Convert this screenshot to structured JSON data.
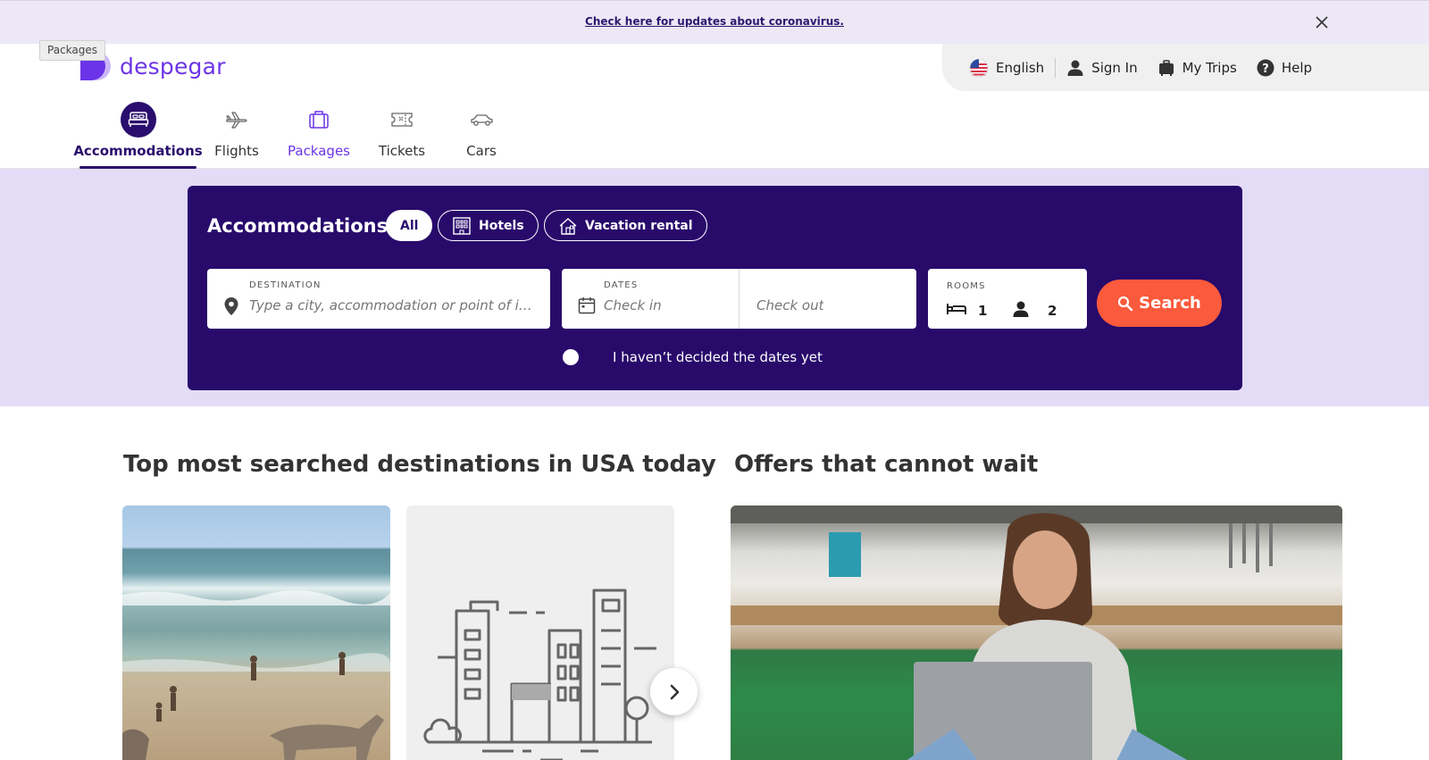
{
  "banner": {
    "link_text": "Check here for updates about coronavirus."
  },
  "tooltip": {
    "text": "Packages"
  },
  "brand": {
    "name": "despegar",
    "color": "#6b34e8"
  },
  "topbar": {
    "language": "English",
    "sign_in": "Sign In",
    "my_trips": "My Trips",
    "help": "Help"
  },
  "products": [
    {
      "label": "Accommodations",
      "icon": "bed-icon",
      "active": true
    },
    {
      "label": "Flights",
      "icon": "plane-icon"
    },
    {
      "label": "Packages",
      "icon": "suitcase-icon"
    },
    {
      "label": "Tickets",
      "icon": "ticket-icon"
    },
    {
      "label": "Cars",
      "icon": "car-icon"
    }
  ],
  "search": {
    "title": "Accommodations",
    "filters": [
      {
        "label": "All",
        "selected": true
      },
      {
        "label": "Hotels",
        "icon": "hotel-icon"
      },
      {
        "label": "Vacation rental",
        "icon": "house-icon"
      }
    ],
    "destination": {
      "label": "DESTINATION",
      "placeholder": "Type a city, accommodation or point of int..."
    },
    "dates": {
      "label": "DATES",
      "check_in": "Check in",
      "check_out": "Check out"
    },
    "rooms": {
      "label": "ROOMS",
      "rooms_count": "1",
      "guests_count": "2"
    },
    "button": "Search",
    "no_dates": "I haven’t decided the dates yet"
  },
  "sections": {
    "top_destinations": "Top most searched destinations in USA today",
    "offers": "Offers that cannot wait"
  },
  "colors": {
    "primary_dark": "#280a6b",
    "hero_bg": "#e3dcf6",
    "search_button": "#fb5a3c"
  }
}
